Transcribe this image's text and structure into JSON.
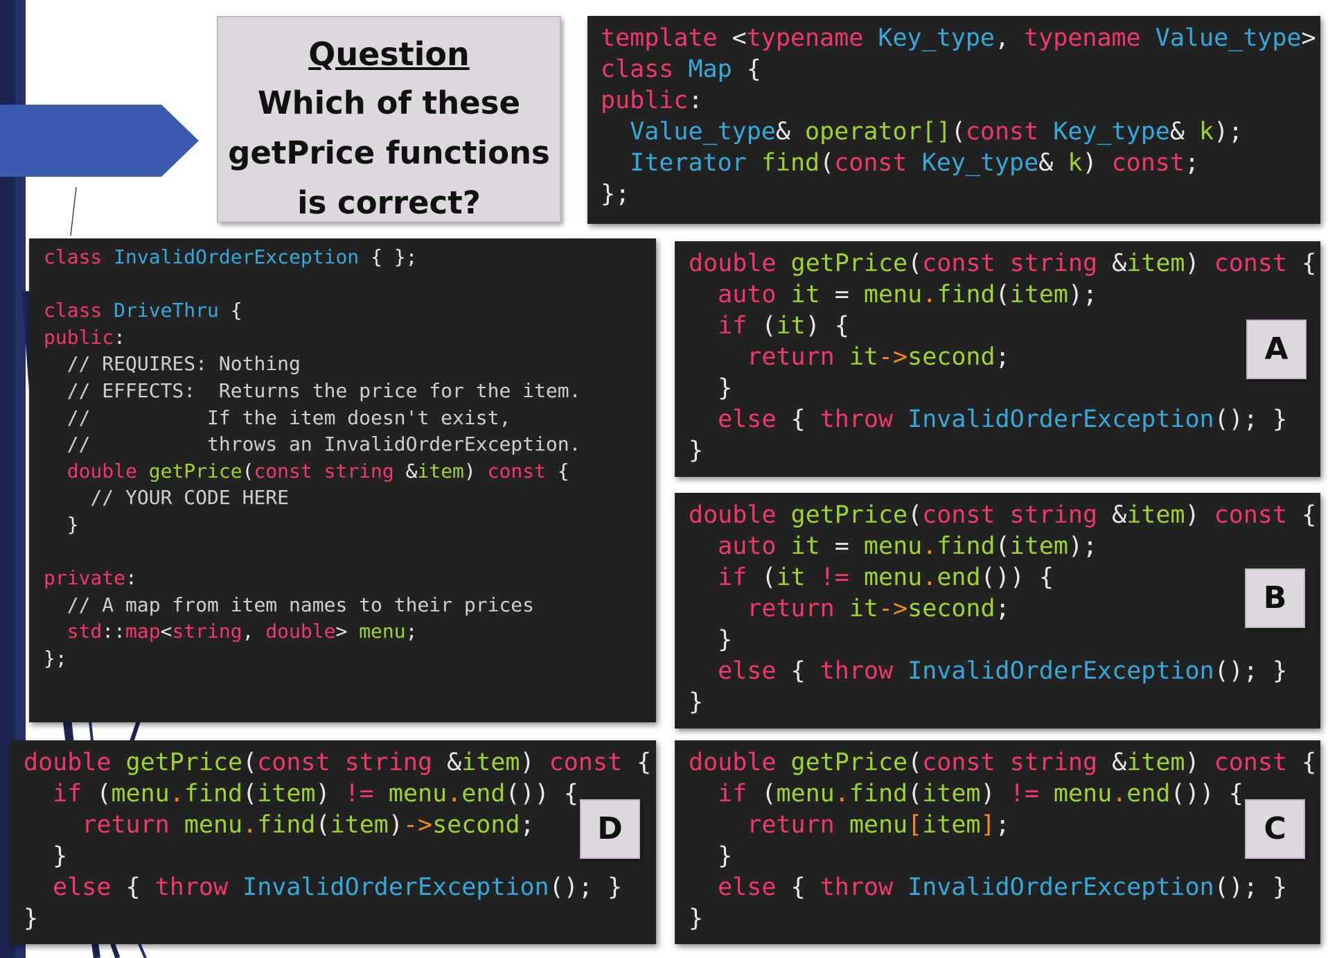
{
  "question": {
    "title": "Question",
    "lines": [
      "Which of these",
      "getPrice functions",
      "is correct?"
    ]
  },
  "map_snippet": {
    "line1": {
      "kw_template": "template",
      "open": "<",
      "kw_typename1": "typename",
      "type_key": "Key_type",
      "comma": ",",
      "kw_typename2": "typename",
      "type_value": "Value_type",
      "close": ">"
    },
    "line2": {
      "kw_class": "class",
      "type_map": "Map",
      "brace": "{"
    },
    "line3": {
      "kw_public": "public",
      "colon": ":"
    },
    "line4": {
      "type_value": "Value_type",
      "amp": "&",
      "func": "operator[]",
      "paren": "(",
      "kw_const": "const",
      "type_key": "Key_type",
      "amp2": "&",
      "param": "k",
      "end": ");"
    },
    "line5": {
      "type_iter": "Iterator",
      "func": "find",
      "paren": "(",
      "kw_const": "const",
      "type_key": "Key_type",
      "amp": "&",
      "param": "k",
      "close": ")",
      "kw_const2": "const",
      "end": ";"
    },
    "line6": {
      "text": "};"
    }
  },
  "drivethru_snippet": {
    "l1": {
      "kw": "class",
      "type": "InvalidOrderException",
      "rest": "{ };"
    },
    "l2": {
      "kw": "class",
      "type": "DriveThru",
      "rest": "{"
    },
    "l3": {
      "kw": "public",
      "rest": ":"
    },
    "l4": "// REQUIRES: Nothing",
    "l5": "// EFFECTS:  Returns the price for the item.",
    "l6": "//          If the item doesn't exist,",
    "l7": "//          throws an InvalidOrderException.",
    "l8": {
      "kw1": "double",
      "func": "getPrice",
      "p1": "(",
      "kw2": "const",
      "kw3": "string",
      "amp": "&",
      "param": "item",
      "p2": ")",
      "kw4": "const",
      "brace": "{"
    },
    "l9": "// YOUR CODE HERE",
    "l10": "}",
    "l11": {
      "kw": "private",
      "rest": ":"
    },
    "l12": "// A map from item names to their prices",
    "l13": {
      "ns": "std",
      "sep": "::",
      "map": "map",
      "lt": "<",
      "t1": "string",
      "comma": ",",
      "t2": "double",
      "gt": ">",
      "name": "menu",
      "end": ";"
    },
    "l14": "};"
  },
  "common": {
    "kw_double": "double",
    "func_getPrice": "getPrice",
    "open_paren": "(",
    "kw_const": "const",
    "kw_string": "string",
    "amp": "&",
    "param_item": "item",
    "close_paren": ")",
    "brace_open": "{",
    "brace_close": "}",
    "kw_auto": "auto",
    "var_it": "it",
    "eq": "=",
    "menu": "menu",
    "dot": ".",
    "find": "find",
    "end": "end",
    "kw_if": "if",
    "neq": "!=",
    "kw_return": "return",
    "arrow": "->",
    "second": "second",
    "semi": ";",
    "kw_else": "else",
    "kw_throw": "throw",
    "exception": "InvalidOrderException",
    "call_end": "();",
    "lbracket": "[",
    "rbracket": "]"
  },
  "options": {
    "a": "A",
    "b": "B",
    "c": "C",
    "d": "D"
  }
}
